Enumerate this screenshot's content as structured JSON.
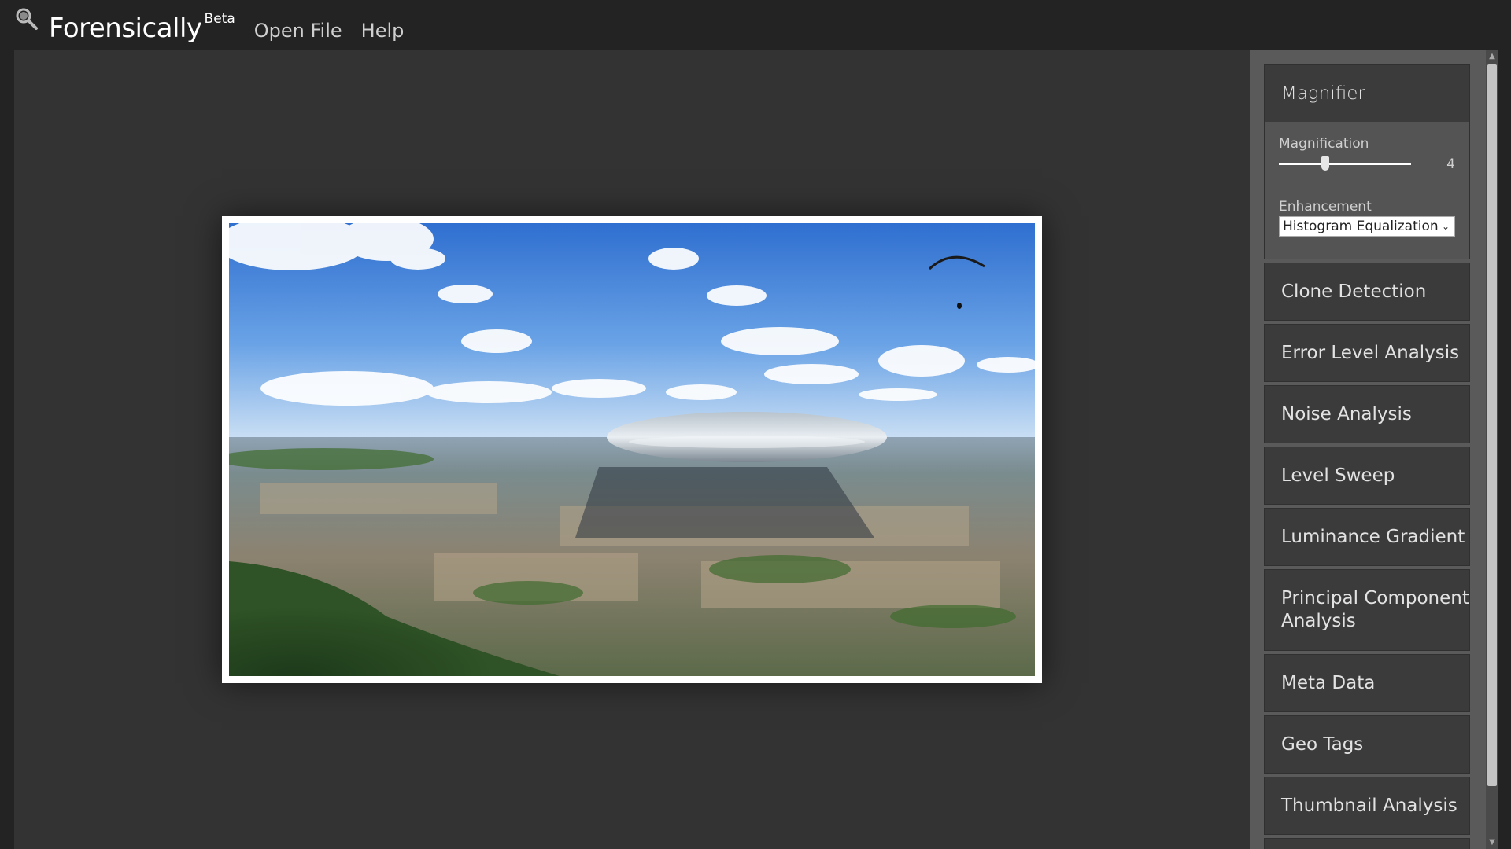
{
  "header": {
    "title": "Forensically",
    "superscript": "Beta",
    "menu": [
      "Open File",
      "Help"
    ]
  },
  "colors": {
    "background": "#232323",
    "canvas": "#333333",
    "sidebar": "#5a5a5a",
    "panel": "#3b3b3b",
    "panel_active_body": "#545454",
    "text": "#e2e2e2"
  },
  "magnifier": {
    "title": "Magnifier",
    "magnification_label": "Magnification",
    "magnification_value": "4",
    "enhancement_label": "Enhancement",
    "enhancement_value": "Histogram Equalization"
  },
  "tools": [
    "Clone Detection",
    "Error Level Analysis",
    "Noise Analysis",
    "Level Sweep",
    "Luminance Gradient",
    "Principal Component Analysis",
    "Meta Data",
    "Geo Tags",
    "Thumbnail Analysis"
  ],
  "icons": {
    "logo": "magnifier-icon",
    "select_arrow": "chevron-down-icon",
    "scroll_up": "arrow-up-icon",
    "scroll_down": "arrow-down-icon"
  }
}
